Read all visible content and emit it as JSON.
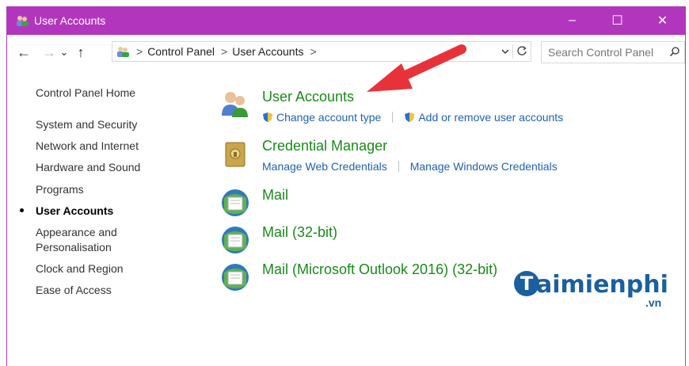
{
  "window": {
    "title": "User Accounts",
    "controls": {
      "minimize": "–",
      "maximize": "☐",
      "close": "✕"
    },
    "colors": {
      "titlebar": "#b236bd",
      "link": "#1f62b0",
      "heading": "#1a8a1a"
    }
  },
  "nav": {
    "back": "←",
    "forward": "→",
    "recent": "⌄",
    "up": "↑"
  },
  "address": {
    "crumbs": [
      "Control Panel",
      "User Accounts"
    ],
    "separator": ">"
  },
  "search": {
    "placeholder": "Search Control Panel"
  },
  "sidebar": {
    "items": [
      {
        "label": "Control Panel Home"
      },
      {
        "label": "System and Security"
      },
      {
        "label": "Network and Internet"
      },
      {
        "label": "Hardware and Sound"
      },
      {
        "label": "Programs"
      },
      {
        "label": "User Accounts",
        "active": true
      },
      {
        "label": "Appearance and",
        "label2": "Personalisation"
      },
      {
        "label": "Clock and Region"
      },
      {
        "label": "Ease of Access"
      }
    ]
  },
  "entries": [
    {
      "heading": "User Accounts",
      "links": [
        "Change account type",
        "Add or remove user accounts"
      ]
    },
    {
      "heading": "Credential Manager",
      "links": [
        "Manage Web Credentials",
        "Manage Windows Credentials"
      ]
    },
    {
      "heading": "Mail"
    },
    {
      "heading": "Mail (32-bit)"
    },
    {
      "heading": "Mail (Microsoft Outlook 2016) (32-bit)"
    }
  ],
  "watermark": {
    "brand": "aimienphi",
    "initial": "T",
    "tld": ".vn"
  }
}
